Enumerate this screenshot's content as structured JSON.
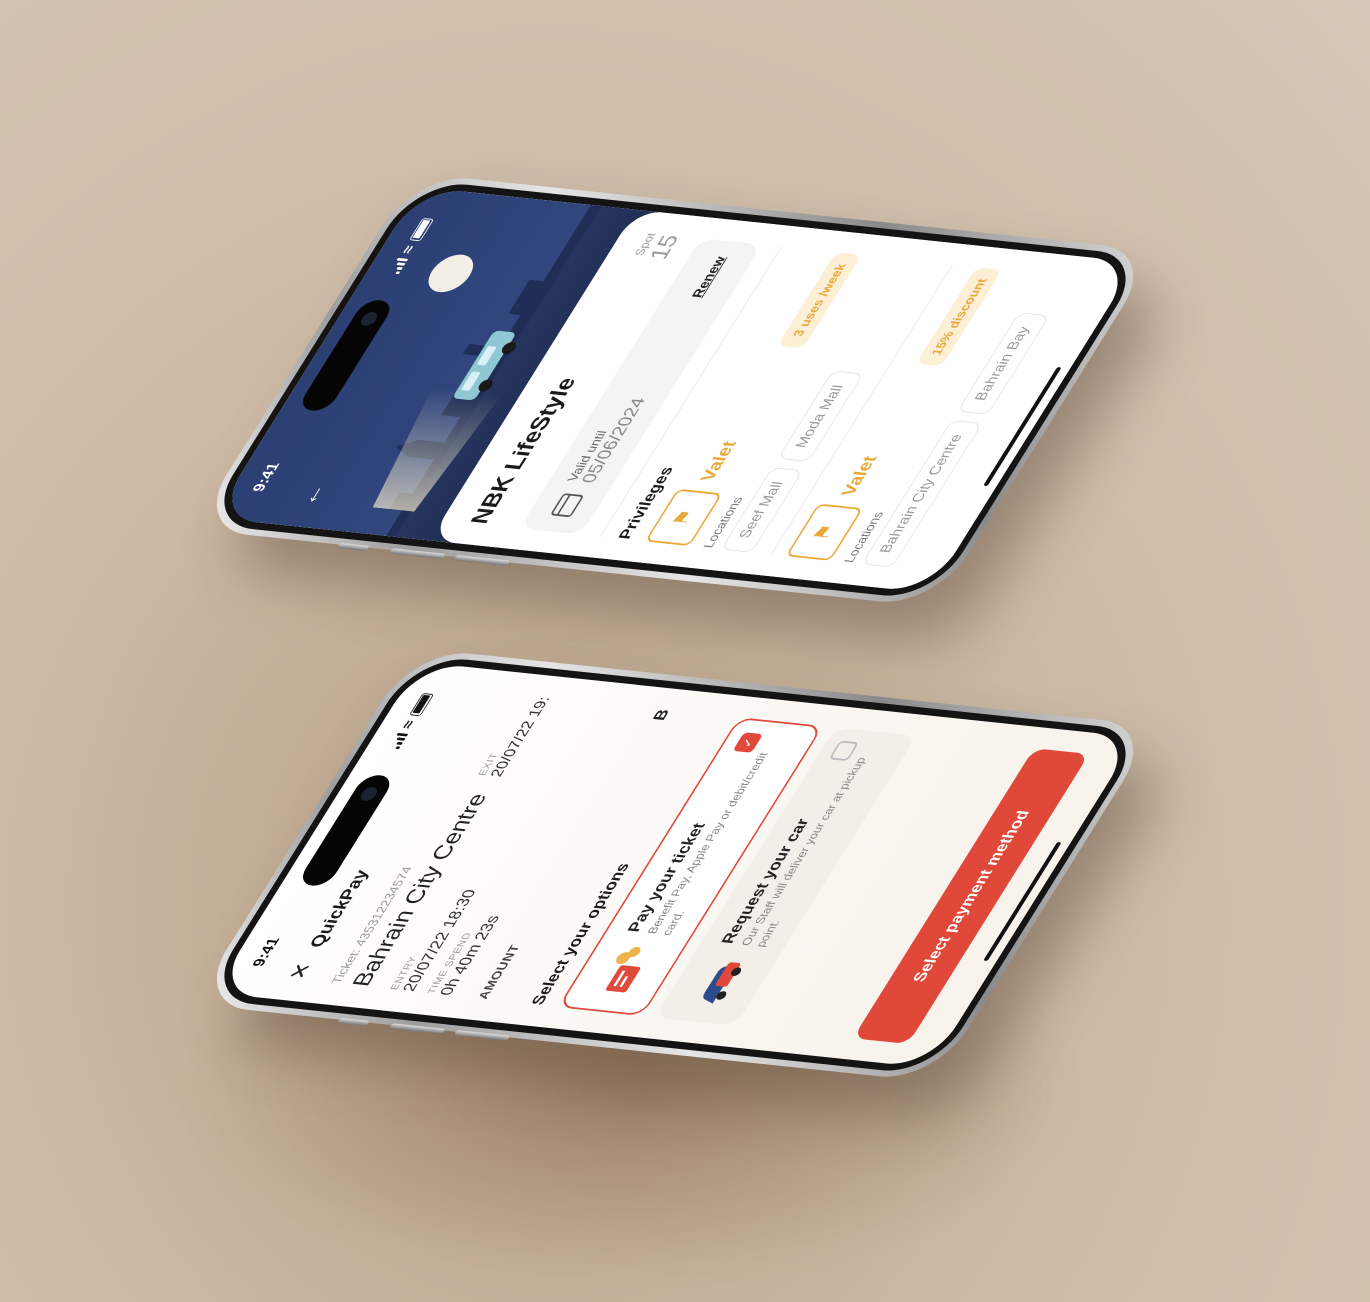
{
  "status_bar": {
    "time": "9:41"
  },
  "lifestyle": {
    "title": "NBK LifeStyle",
    "spot_label": "Spot",
    "spot_number": "15",
    "valid_label": "Valid until",
    "valid_date": "05/06/2024",
    "renew_label": "Renew",
    "privileges_title": "Privileges",
    "locations_label": "Locations",
    "privileges": [
      {
        "name": "Valet",
        "badge": "3 uses /week",
        "locations": [
          "Seef Mall",
          "Moda Mall"
        ]
      },
      {
        "name": "Valet",
        "badge": "15% discount",
        "locations": [
          "Bahrain City Centre",
          "Bahrain Bay"
        ]
      }
    ]
  },
  "quickpay": {
    "title": "QuickPay",
    "ticket": "Ticket: 435312234574",
    "location": "Bahrain City Centre",
    "entry_label": "ENTRY",
    "entry_value": "20/07/22 18:30",
    "exit_label": "EXIT",
    "exit_value": "20/07/22 19:",
    "time_label": "TIME SPEND",
    "time_value": "0h 40m 23s",
    "amount_label": "AMOUNT",
    "amount_value": "B",
    "options_title": "Select your options",
    "options": [
      {
        "title": "Pay your ticket",
        "desc": "Benefit Pay, Apple Pay or debit/credit card.",
        "selected": true
      },
      {
        "title": "Request your car",
        "desc": "Our Staff will deliver your car at pickup point.",
        "selected": false
      }
    ],
    "button_label": "Select payment method"
  },
  "colors": {
    "accent_red": "#e0483a",
    "accent_gold": "#e9a93a",
    "hero_blue": "#2b3f73"
  }
}
